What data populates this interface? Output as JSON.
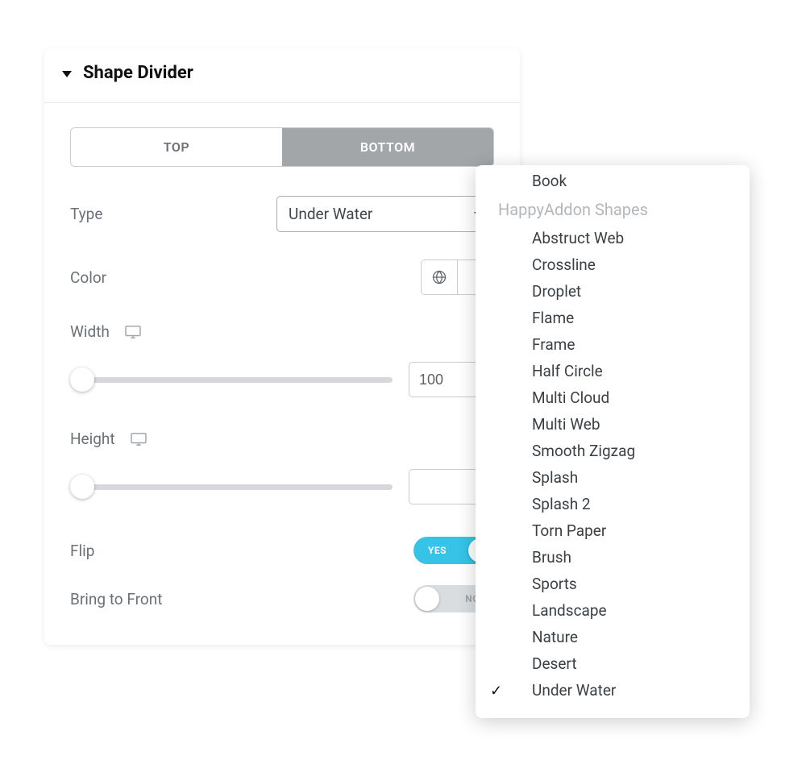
{
  "panel": {
    "title": "Shape Divider",
    "tabs": {
      "top": "TOP",
      "bottom": "BOTTOM",
      "active": "bottom"
    },
    "type": {
      "label": "Type",
      "value": "Under Water"
    },
    "color": {
      "label": "Color"
    },
    "width": {
      "label": "Width",
      "value": "100"
    },
    "height": {
      "label": "Height",
      "value": ""
    },
    "flip": {
      "label": "Flip",
      "state": "on",
      "text": "YES"
    },
    "front": {
      "label": "Bring to Front",
      "state": "off",
      "text": "NO"
    }
  },
  "dropdown": {
    "partial_top_item": "Book",
    "group_label": "HappyAddon Shapes",
    "items": [
      "Abstruct Web",
      "Crossline",
      "Droplet",
      "Flame",
      "Frame",
      "Half Circle",
      "Multi Cloud",
      "Multi Web",
      "Smooth Zigzag",
      "Splash",
      "Splash 2",
      "Torn Paper",
      "Brush",
      "Sports",
      "Landscape",
      "Nature",
      "Desert",
      "Under Water"
    ],
    "selected": "Under Water"
  }
}
